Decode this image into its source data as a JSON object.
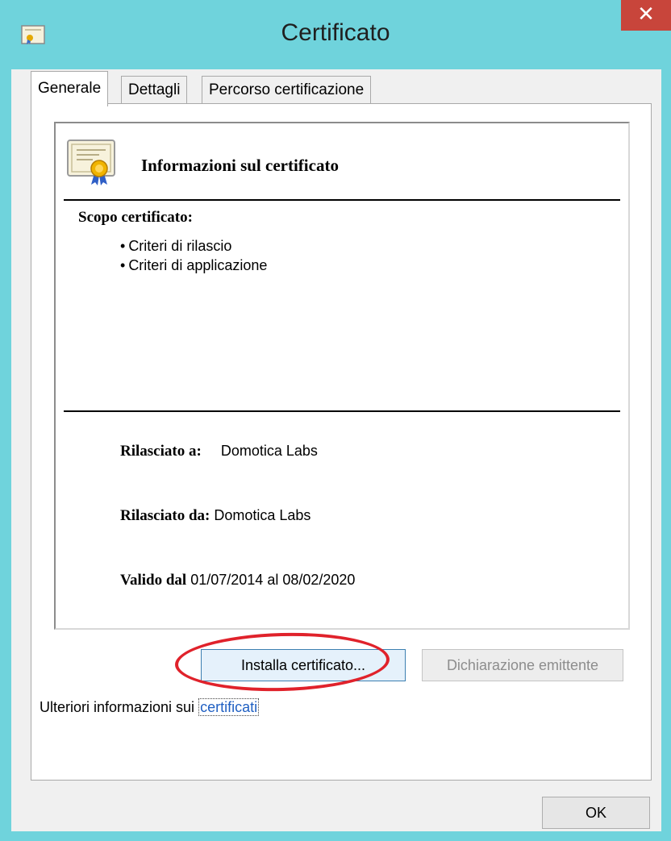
{
  "window": {
    "title": "Certificato",
    "close_label": "✕"
  },
  "tabs": [
    {
      "label": "Generale",
      "active": true
    },
    {
      "label": "Dettagli",
      "active": false
    },
    {
      "label": "Percorso certificazione",
      "active": false
    }
  ],
  "info": {
    "header": "Informazioni sul certificato",
    "purpose_label": "Scopo certificato:",
    "purposes": [
      "Criteri di rilascio",
      "Criteri di applicazione"
    ],
    "issued_to_label": "Rilasciato a:",
    "issued_to_value": "Domotica Labs",
    "issued_by_label": "Rilasciato da:",
    "issued_by_value": "Domotica Labs",
    "valid_from_label": "Valido dal",
    "valid_from_value": "01/07/2014",
    "valid_to_label": "al",
    "valid_to_value": "08/02/2020"
  },
  "buttons": {
    "install": "Installa certificato...",
    "issuer_statement": "Dichiarazione emittente",
    "ok": "OK"
  },
  "more_info": {
    "text": "Ulteriori informazioni sui",
    "link": "certificati"
  },
  "colors": {
    "title_bar": "#6fd3dc",
    "close_button": "#c8453b",
    "highlight_ring": "#e0222b",
    "link": "#1f5fc2"
  },
  "icons": {
    "title": "certificate-icon",
    "info": "certificate-icon",
    "close": "close-icon"
  }
}
